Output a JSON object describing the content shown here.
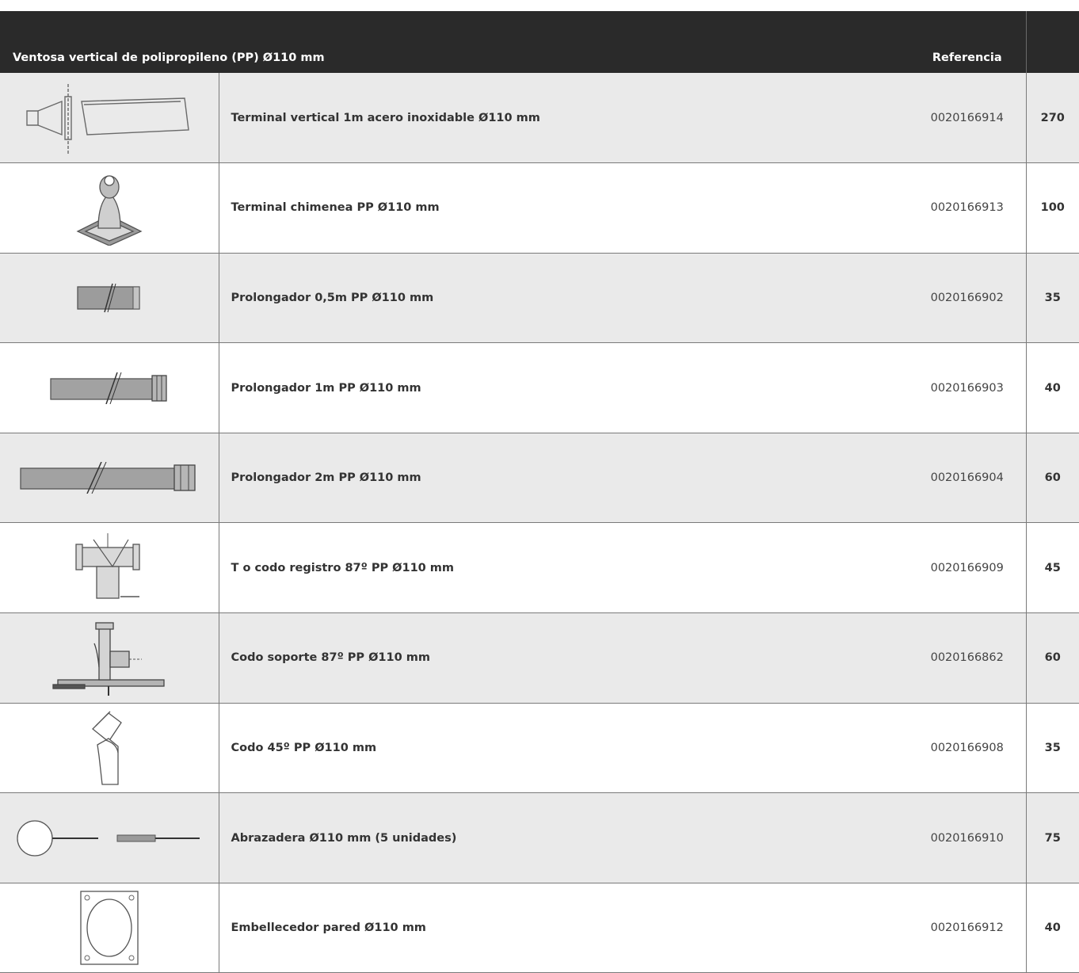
{
  "header": {
    "product_label": "Ventosa vertical de polipropileno (PP) Ø110 mm",
    "reference_label": "Referencia",
    "price_label": ""
  },
  "rows": [
    {
      "icon": "terminal-vertical-icon",
      "description": "Terminal vertical 1m acero inoxidable Ø110 mm",
      "reference": "0020166914",
      "price": "270"
    },
    {
      "icon": "chimney-terminal-icon",
      "description": "Terminal chimenea PP Ø110 mm",
      "reference": "0020166913",
      "price": "100"
    },
    {
      "icon": "pipe-extension-short-icon",
      "description": "Prolongador 0,5m PP Ø110 mm",
      "reference": "0020166902",
      "price": "35"
    },
    {
      "icon": "pipe-extension-1m-icon",
      "description": "Prolongador 1m PP Ø110 mm",
      "reference": "0020166903",
      "price": "40"
    },
    {
      "icon": "pipe-extension-2m-icon",
      "description": "Prolongador 2m PP Ø110 mm",
      "reference": "0020166904",
      "price": "60"
    },
    {
      "icon": "tee-elbow-icon",
      "description": "T o codo registro 87º PP Ø110 mm",
      "reference": "0020166909",
      "price": "45"
    },
    {
      "icon": "support-elbow-icon",
      "description": "Codo soporte 87º PP Ø110 mm",
      "reference": "0020166862",
      "price": "60"
    },
    {
      "icon": "elbow-45-icon",
      "description": "Codo 45º PP Ø110 mm",
      "reference": "0020166908",
      "price": "35"
    },
    {
      "icon": "clamp-icon",
      "description": "Abrazadera Ø110 mm (5 unidades)",
      "reference": "0020166910",
      "price": "75"
    },
    {
      "icon": "wall-trim-icon",
      "description": "Embellecedor pared Ø110 mm",
      "reference": "0020166912",
      "price": "40"
    }
  ]
}
